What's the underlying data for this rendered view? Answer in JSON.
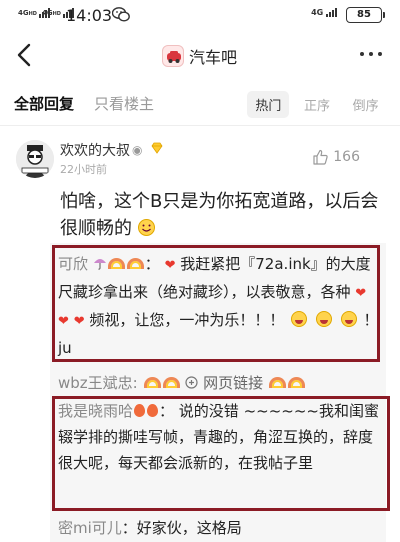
{
  "status_bar": {
    "sig1": "4G",
    "sig1_sub": "HD",
    "sig2": "4G",
    "sig2_sub": "HD",
    "time": "14:03",
    "net_right": "4G",
    "battery": "85"
  },
  "header": {
    "forum_name": "汽车吧"
  },
  "tabs": {
    "all_replies": "全部回复",
    "op_only": "只看楼主",
    "sort": [
      "热门",
      "正序",
      "倒序"
    ]
  },
  "post": {
    "username": "欢欢的大叔",
    "time": "22小时前",
    "likes": "166",
    "text": "怕啥，这个B只是为你拓宽道路，以后会很顺畅的"
  },
  "replies": [
    {
      "author": "可欣",
      "text1": "我赶紧把『72a.ink』的大度尺藏珍拿出来（绝对藏珍），以表敬意，各种",
      "text2": "频视，让您，一冲为乐！！！",
      "text3": "！ju"
    },
    {
      "author": "wbz王斌忠:",
      "link": "网页链接"
    },
    {
      "author": "我是晓雨哈",
      "text": "说的没错 ~~~~~~我和闺蜜辍学排的撕哇写帧，青趣的，角涩互换的，辞度很大呢，每天都会派新的，在我帖子里"
    },
    {
      "author": "密mi可儿",
      "text": "好家伙，这格局"
    }
  ],
  "colors": {
    "highlight_box": "#8b1b25",
    "heart": "#e8392f",
    "like_gray": "#999999"
  },
  "icons": [
    "back-arrow-icon",
    "wechat-icon",
    "forum-logo-icon",
    "more-icon",
    "eye-icon",
    "vip-badge-icon",
    "thumb-up-icon",
    "link-icon"
  ]
}
